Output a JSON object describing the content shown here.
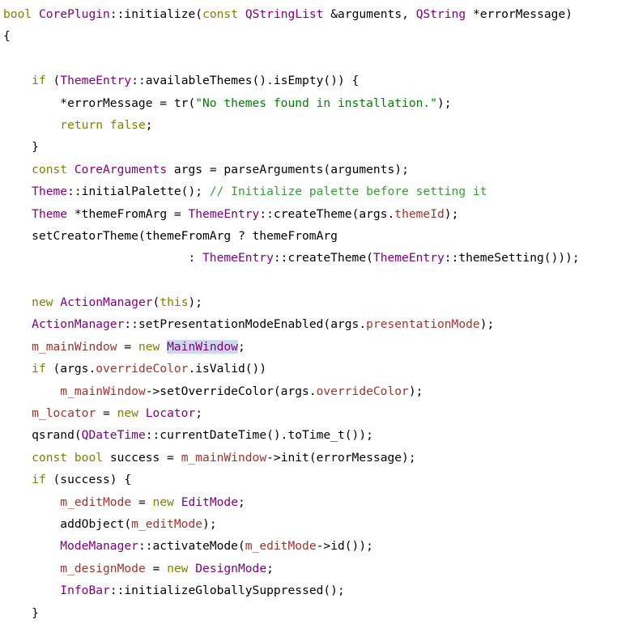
{
  "editor": {
    "language": "C++",
    "background": "#ffffff",
    "selection_color": "#cdd8e8",
    "palette": {
      "plain": "#000000",
      "keyword": "#808000",
      "type": "#800080",
      "function": "#000000",
      "string": "#008000",
      "comment": "#32a032",
      "member": "#a0342c"
    },
    "lines": [
      {
        "index": 0,
        "text": "bool CorePlugin::initialize(const QStringList &arguments, QString *errorMessage)",
        "tokens": [
          {
            "t": "bool",
            "c": "keyword"
          },
          {
            "t": " ",
            "c": "plain"
          },
          {
            "t": "CorePlugin",
            "c": "type"
          },
          {
            "t": "::",
            "c": "plain"
          },
          {
            "t": "initialize",
            "c": "function"
          },
          {
            "t": "(",
            "c": "plain"
          },
          {
            "t": "const",
            "c": "keyword"
          },
          {
            "t": " ",
            "c": "plain"
          },
          {
            "t": "QStringList",
            "c": "type"
          },
          {
            "t": " &arguments, ",
            "c": "plain"
          },
          {
            "t": "QString",
            "c": "type"
          },
          {
            "t": " *errorMessage)",
            "c": "plain"
          }
        ]
      },
      {
        "index": 1,
        "text": "{",
        "tokens": [
          {
            "t": "{",
            "c": "plain"
          }
        ]
      },
      {
        "index": 2,
        "text": "",
        "tokens": []
      },
      {
        "index": 3,
        "text": "    if (ThemeEntry::availableThemes().isEmpty()) {",
        "tokens": [
          {
            "t": "    ",
            "c": "plain"
          },
          {
            "t": "if",
            "c": "keyword"
          },
          {
            "t": " (",
            "c": "plain"
          },
          {
            "t": "ThemeEntry",
            "c": "type"
          },
          {
            "t": "::availableThemes().isEmpty()) {",
            "c": "plain"
          }
        ]
      },
      {
        "index": 4,
        "text": "        *errorMessage = tr(\"No themes found in installation.\");",
        "tokens": [
          {
            "t": "        *errorMessage = tr(",
            "c": "plain"
          },
          {
            "t": "\"No themes found in installation.\"",
            "c": "string"
          },
          {
            "t": ");",
            "c": "plain"
          }
        ]
      },
      {
        "index": 5,
        "text": "        return false;",
        "tokens": [
          {
            "t": "        ",
            "c": "plain"
          },
          {
            "t": "return false",
            "c": "keyword"
          },
          {
            "t": ";",
            "c": "plain"
          }
        ]
      },
      {
        "index": 6,
        "text": "    }",
        "tokens": [
          {
            "t": "    }",
            "c": "plain"
          }
        ]
      },
      {
        "index": 7,
        "text": "    const CoreArguments args = parseArguments(arguments);",
        "tokens": [
          {
            "t": "    ",
            "c": "plain"
          },
          {
            "t": "const",
            "c": "keyword"
          },
          {
            "t": " ",
            "c": "plain"
          },
          {
            "t": "CoreArguments",
            "c": "type"
          },
          {
            "t": " args = parseArguments(arguments);",
            "c": "plain"
          }
        ]
      },
      {
        "index": 8,
        "text": "    Theme::initialPalette(); // Initialize palette before setting it",
        "tokens": [
          {
            "t": "    ",
            "c": "plain"
          },
          {
            "t": "Theme",
            "c": "type"
          },
          {
            "t": "::initialPalette(); ",
            "c": "plain"
          },
          {
            "t": "// Initialize palette before setting it",
            "c": "comment"
          }
        ]
      },
      {
        "index": 9,
        "text": "    Theme *themeFromArg = ThemeEntry::createTheme(args.themeId);",
        "tokens": [
          {
            "t": "    ",
            "c": "plain"
          },
          {
            "t": "Theme",
            "c": "type"
          },
          {
            "t": " *themeFromArg = ",
            "c": "plain"
          },
          {
            "t": "ThemeEntry",
            "c": "type"
          },
          {
            "t": "::createTheme(args.",
            "c": "plain"
          },
          {
            "t": "themeId",
            "c": "member"
          },
          {
            "t": ");",
            "c": "plain"
          }
        ]
      },
      {
        "index": 10,
        "text": "    setCreatorTheme(themeFromArg ? themeFromArg",
        "tokens": [
          {
            "t": "    setCreatorTheme(themeFromArg ? themeFromArg",
            "c": "plain"
          }
        ]
      },
      {
        "index": 11,
        "text": "                          : ThemeEntry::createTheme(ThemeEntry::themeSetting()));",
        "tokens": [
          {
            "t": "                          : ",
            "c": "plain"
          },
          {
            "t": "ThemeEntry",
            "c": "type"
          },
          {
            "t": "::createTheme(",
            "c": "plain"
          },
          {
            "t": "ThemeEntry",
            "c": "type"
          },
          {
            "t": "::themeSetting()));",
            "c": "plain"
          }
        ]
      },
      {
        "index": 12,
        "text": "",
        "tokens": []
      },
      {
        "index": 13,
        "text": "    new ActionManager(this);",
        "tokens": [
          {
            "t": "    ",
            "c": "plain"
          },
          {
            "t": "new",
            "c": "keyword"
          },
          {
            "t": " ",
            "c": "plain"
          },
          {
            "t": "ActionManager",
            "c": "type"
          },
          {
            "t": "(",
            "c": "plain"
          },
          {
            "t": "this",
            "c": "keyword"
          },
          {
            "t": ");",
            "c": "plain"
          }
        ]
      },
      {
        "index": 14,
        "text": "    ActionManager::setPresentationModeEnabled(args.presentationMode);",
        "tokens": [
          {
            "t": "    ",
            "c": "plain"
          },
          {
            "t": "ActionManager",
            "c": "type"
          },
          {
            "t": "::setPresentationModeEnabled(args.",
            "c": "plain"
          },
          {
            "t": "presentationMode",
            "c": "member"
          },
          {
            "t": ");",
            "c": "plain"
          }
        ]
      },
      {
        "index": 15,
        "text": "    m_mainWindow = new MainWindow;",
        "selection": "MainWindow",
        "tokens": [
          {
            "t": "    ",
            "c": "plain"
          },
          {
            "t": "m_mainWindow",
            "c": "member"
          },
          {
            "t": " = ",
            "c": "plain"
          },
          {
            "t": "new",
            "c": "keyword"
          },
          {
            "t": " ",
            "c": "plain"
          },
          {
            "t": "MainWindow",
            "c": "type",
            "sel": true
          },
          {
            "t": ";",
            "c": "plain"
          }
        ]
      },
      {
        "index": 16,
        "text": "    if (args.overrideColor.isValid())",
        "tokens": [
          {
            "t": "    ",
            "c": "plain"
          },
          {
            "t": "if",
            "c": "keyword"
          },
          {
            "t": " (args.",
            "c": "plain"
          },
          {
            "t": "overrideColor",
            "c": "member"
          },
          {
            "t": ".isValid())",
            "c": "plain"
          }
        ]
      },
      {
        "index": 17,
        "text": "        m_mainWindow->setOverrideColor(args.overrideColor);",
        "tokens": [
          {
            "t": "        ",
            "c": "plain"
          },
          {
            "t": "m_mainWindow",
            "c": "member"
          },
          {
            "t": "->setOverrideColor(args.",
            "c": "plain"
          },
          {
            "t": "overrideColor",
            "c": "member"
          },
          {
            "t": ");",
            "c": "plain"
          }
        ]
      },
      {
        "index": 18,
        "text": "    m_locator = new Locator;",
        "tokens": [
          {
            "t": "    ",
            "c": "plain"
          },
          {
            "t": "m_locator",
            "c": "member"
          },
          {
            "t": " = ",
            "c": "plain"
          },
          {
            "t": "new",
            "c": "keyword"
          },
          {
            "t": " ",
            "c": "plain"
          },
          {
            "t": "Locator",
            "c": "type"
          },
          {
            "t": ";",
            "c": "plain"
          }
        ]
      },
      {
        "index": 19,
        "text": "    qsrand(QDateTime::currentDateTime().toTime_t());",
        "tokens": [
          {
            "t": "    qsrand(",
            "c": "plain"
          },
          {
            "t": "QDateTime",
            "c": "type"
          },
          {
            "t": "::currentDateTime().toTime_t());",
            "c": "plain"
          }
        ]
      },
      {
        "index": 20,
        "text": "    const bool success = m_mainWindow->init(errorMessage);",
        "tokens": [
          {
            "t": "    ",
            "c": "plain"
          },
          {
            "t": "const bool",
            "c": "keyword"
          },
          {
            "t": " success = ",
            "c": "plain"
          },
          {
            "t": "m_mainWindow",
            "c": "member"
          },
          {
            "t": "->init(errorMessage);",
            "c": "plain"
          }
        ]
      },
      {
        "index": 21,
        "text": "    if (success) {",
        "tokens": [
          {
            "t": "    ",
            "c": "plain"
          },
          {
            "t": "if",
            "c": "keyword"
          },
          {
            "t": " (success) {",
            "c": "plain"
          }
        ]
      },
      {
        "index": 22,
        "text": "        m_editMode = new EditMode;",
        "tokens": [
          {
            "t": "        ",
            "c": "plain"
          },
          {
            "t": "m_editMode",
            "c": "member"
          },
          {
            "t": " = ",
            "c": "plain"
          },
          {
            "t": "new",
            "c": "keyword"
          },
          {
            "t": " ",
            "c": "plain"
          },
          {
            "t": "EditMode",
            "c": "type"
          },
          {
            "t": ";",
            "c": "plain"
          }
        ]
      },
      {
        "index": 23,
        "text": "        addObject(m_editMode);",
        "tokens": [
          {
            "t": "        ",
            "c": "plain"
          },
          {
            "t": "addObject",
            "c": "function"
          },
          {
            "t": "(",
            "c": "plain"
          },
          {
            "t": "m_editMode",
            "c": "member"
          },
          {
            "t": ");",
            "c": "plain"
          }
        ]
      },
      {
        "index": 24,
        "text": "        ModeManager::activateMode(m_editMode->id());",
        "tokens": [
          {
            "t": "        ",
            "c": "plain"
          },
          {
            "t": "ModeManager",
            "c": "type"
          },
          {
            "t": "::activateMode(",
            "c": "plain"
          },
          {
            "t": "m_editMode",
            "c": "member"
          },
          {
            "t": "->id());",
            "c": "plain"
          }
        ]
      },
      {
        "index": 25,
        "text": "        m_designMode = new DesignMode;",
        "tokens": [
          {
            "t": "        ",
            "c": "plain"
          },
          {
            "t": "m_designMode",
            "c": "member"
          },
          {
            "t": " = ",
            "c": "plain"
          },
          {
            "t": "new",
            "c": "keyword"
          },
          {
            "t": " ",
            "c": "plain"
          },
          {
            "t": "DesignMode",
            "c": "type"
          },
          {
            "t": ";",
            "c": "plain"
          }
        ]
      },
      {
        "index": 26,
        "text": "        InfoBar::initializeGloballySuppressed();",
        "tokens": [
          {
            "t": "        ",
            "c": "plain"
          },
          {
            "t": "InfoBar",
            "c": "type"
          },
          {
            "t": "::initializeGloballySuppressed();",
            "c": "plain"
          }
        ]
      },
      {
        "index": 27,
        "text": "    }",
        "tokens": [
          {
            "t": "    }",
            "c": "plain"
          }
        ]
      }
    ]
  }
}
